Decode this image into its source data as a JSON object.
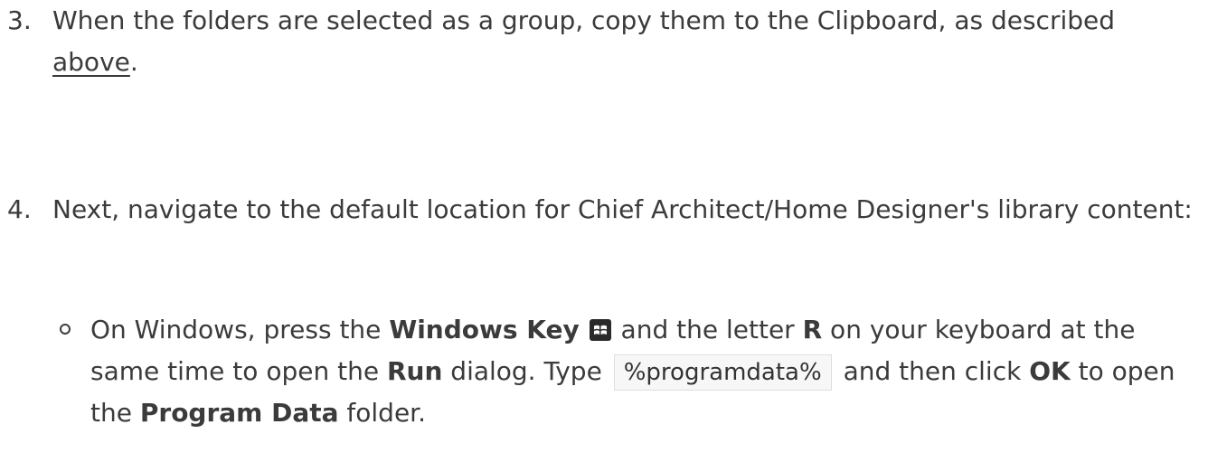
{
  "step3": {
    "number": "3.",
    "text_before": "When the folders are selected as a group, copy them to the Clipboard, as described",
    "link": "above",
    "text_after": "."
  },
  "step4": {
    "number": "4.",
    "text": "Next, navigate to the default location for Chief Architect/Home Designer's library content:",
    "bullet": {
      "t1": "On Windows, press the ",
      "windows_key": "Windows Key",
      "t2": " and the letter ",
      "r": "R",
      "t3": " on your keyboard at the same time to open the ",
      "run": "Run",
      "t4": " dialog. Type ",
      "code": "%programdata%",
      "t5": " and then click ",
      "ok": "OK",
      "t6": " to open the ",
      "program_data": "Program Data",
      "t7": " folder."
    }
  },
  "icons": {
    "windows_key_icon": "windows-logo-key",
    "icon_bg": "#2a2a2a"
  }
}
